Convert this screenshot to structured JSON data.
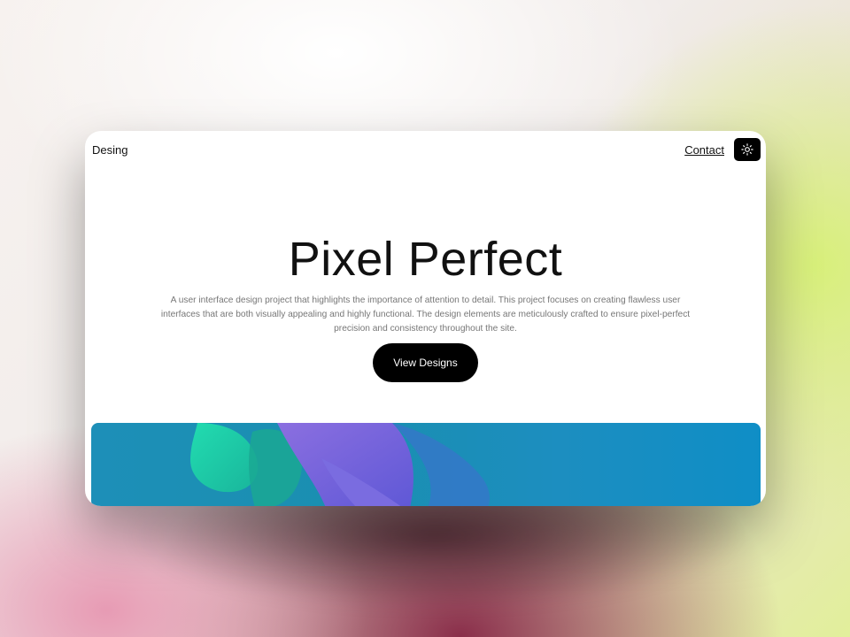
{
  "nav": {
    "brand": "Desing",
    "contact_label": "Contact",
    "theme_icon": "sun-icon"
  },
  "hero": {
    "title": "Pixel Perfect",
    "description": "A user interface design project that highlights the importance of attention to detail. This project focuses on creating flawless user interfaces that are both visually appealing and highly functional. The design elements are meticulously crafted to ensure pixel-perfect precision and consistency throughout the site.",
    "cta_label": "View Designs"
  },
  "colors": {
    "primary_button": "#000000",
    "banner_teal": "#1a8fb0",
    "banner_purple": "#6f63d8",
    "banner_green": "#1fd6a0"
  }
}
